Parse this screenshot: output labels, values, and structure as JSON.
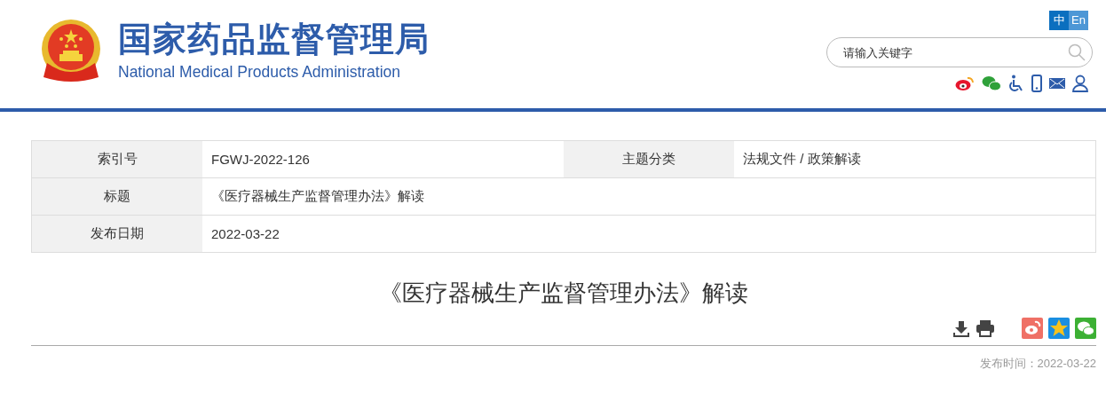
{
  "header": {
    "title_cn": "国家药品监督管理局",
    "title_en": "National Medical Products Administration",
    "languages": [
      {
        "label": "中",
        "selected": true
      },
      {
        "label": "En",
        "selected": false
      }
    ],
    "search": {
      "placeholder": "请输入关键字"
    }
  },
  "meta": {
    "rows": [
      {
        "cells": [
          {
            "label": "索引号",
            "value": "FGWJ-2022-126"
          },
          {
            "label": "主题分类",
            "value": "法规文件 / 政策解读"
          }
        ]
      },
      {
        "cells": [
          {
            "label": "标题",
            "value": "《医疗器械生产监督管理办法》解读"
          }
        ]
      },
      {
        "cells": [
          {
            "label": "发布日期",
            "value": "2022-03-22"
          }
        ]
      }
    ]
  },
  "article": {
    "title": "《医疗器械生产监督管理办法》解读",
    "published": "发布时间：2022-03-22"
  }
}
